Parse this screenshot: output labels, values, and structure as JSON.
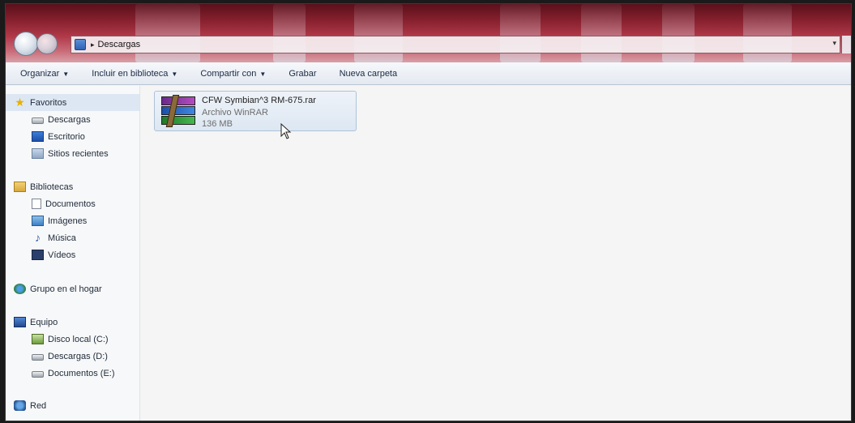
{
  "address": {
    "path_label": "Descargas",
    "separator": "▸"
  },
  "toolbar": {
    "items": [
      {
        "label": "Organizar",
        "has_dropdown": true
      },
      {
        "label": "Incluir en biblioteca",
        "has_dropdown": true
      },
      {
        "label": "Compartir con",
        "has_dropdown": true
      },
      {
        "label": "Grabar",
        "has_dropdown": false
      },
      {
        "label": "Nueva carpeta",
        "has_dropdown": false
      }
    ]
  },
  "sidebar": {
    "favorites": {
      "label": "Favoritos",
      "icon": "star-icon",
      "children": [
        {
          "label": "Descargas",
          "icon": "drive-icon"
        },
        {
          "label": "Escritorio",
          "icon": "desktop-icon"
        },
        {
          "label": "Sitios recientes",
          "icon": "recent-icon"
        }
      ]
    },
    "libraries": {
      "label": "Bibliotecas",
      "icon": "library-icon",
      "children": [
        {
          "label": "Documentos",
          "icon": "doc-icon"
        },
        {
          "label": "Imágenes",
          "icon": "pic-icon"
        },
        {
          "label": "Música",
          "icon": "music-icon"
        },
        {
          "label": "Vídeos",
          "icon": "video-icon"
        }
      ]
    },
    "homegroup": {
      "label": "Grupo en el hogar",
      "icon": "homegroup-icon"
    },
    "computer": {
      "label": "Equipo",
      "icon": "computer-icon",
      "children": [
        {
          "label": "Disco local (C:)",
          "icon": "localdisk-icon"
        },
        {
          "label": "Descargas (D:)",
          "icon": "drive-icon"
        },
        {
          "label": "Documentos (E:)",
          "icon": "drive-icon"
        }
      ]
    },
    "network": {
      "label": "Red",
      "icon": "network-icon"
    }
  },
  "files": [
    {
      "name": "CFW Symbian^3 RM-675.rar",
      "type": "Archivo WinRAR",
      "size": "136 MB",
      "icon": "winrar-archive-icon"
    }
  ],
  "colors": {
    "titlebar": "#8a2230",
    "selection": "#dde7f3",
    "file_selection_border": "#aec2da"
  }
}
